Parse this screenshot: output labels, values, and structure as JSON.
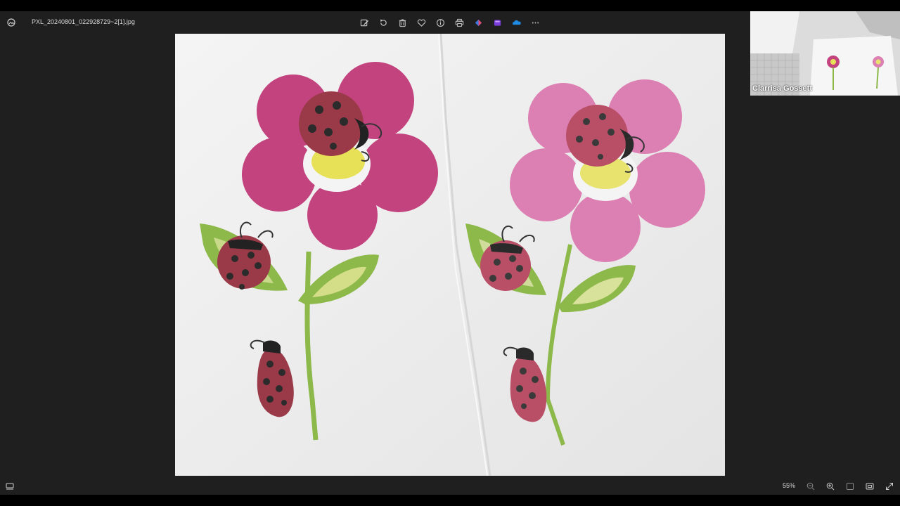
{
  "window": {
    "title": "PXL_20240801_022928729~2[1].jpg"
  },
  "toolbar": {
    "buttons": [
      {
        "name": "edit-image-icon"
      },
      {
        "name": "rotate-icon"
      },
      {
        "name": "delete-icon"
      },
      {
        "name": "favorite-icon"
      },
      {
        "name": "info-icon"
      },
      {
        "name": "print-icon"
      },
      {
        "name": "clipchamp-icon"
      },
      {
        "name": "designer-icon"
      },
      {
        "name": "onedrive-icon"
      },
      {
        "name": "more-options-icon"
      }
    ]
  },
  "video_call": {
    "participant_name": "Clarrisa Gossett"
  },
  "statusbar": {
    "zoom": "55%"
  },
  "colors": {
    "background": "#1f1f1f",
    "petal_dark": "#c3437f",
    "petal_light": "#dc7fb2",
    "center": "#e7e158",
    "leaf": "#8db84a",
    "ladybug": "#9a3a48"
  }
}
